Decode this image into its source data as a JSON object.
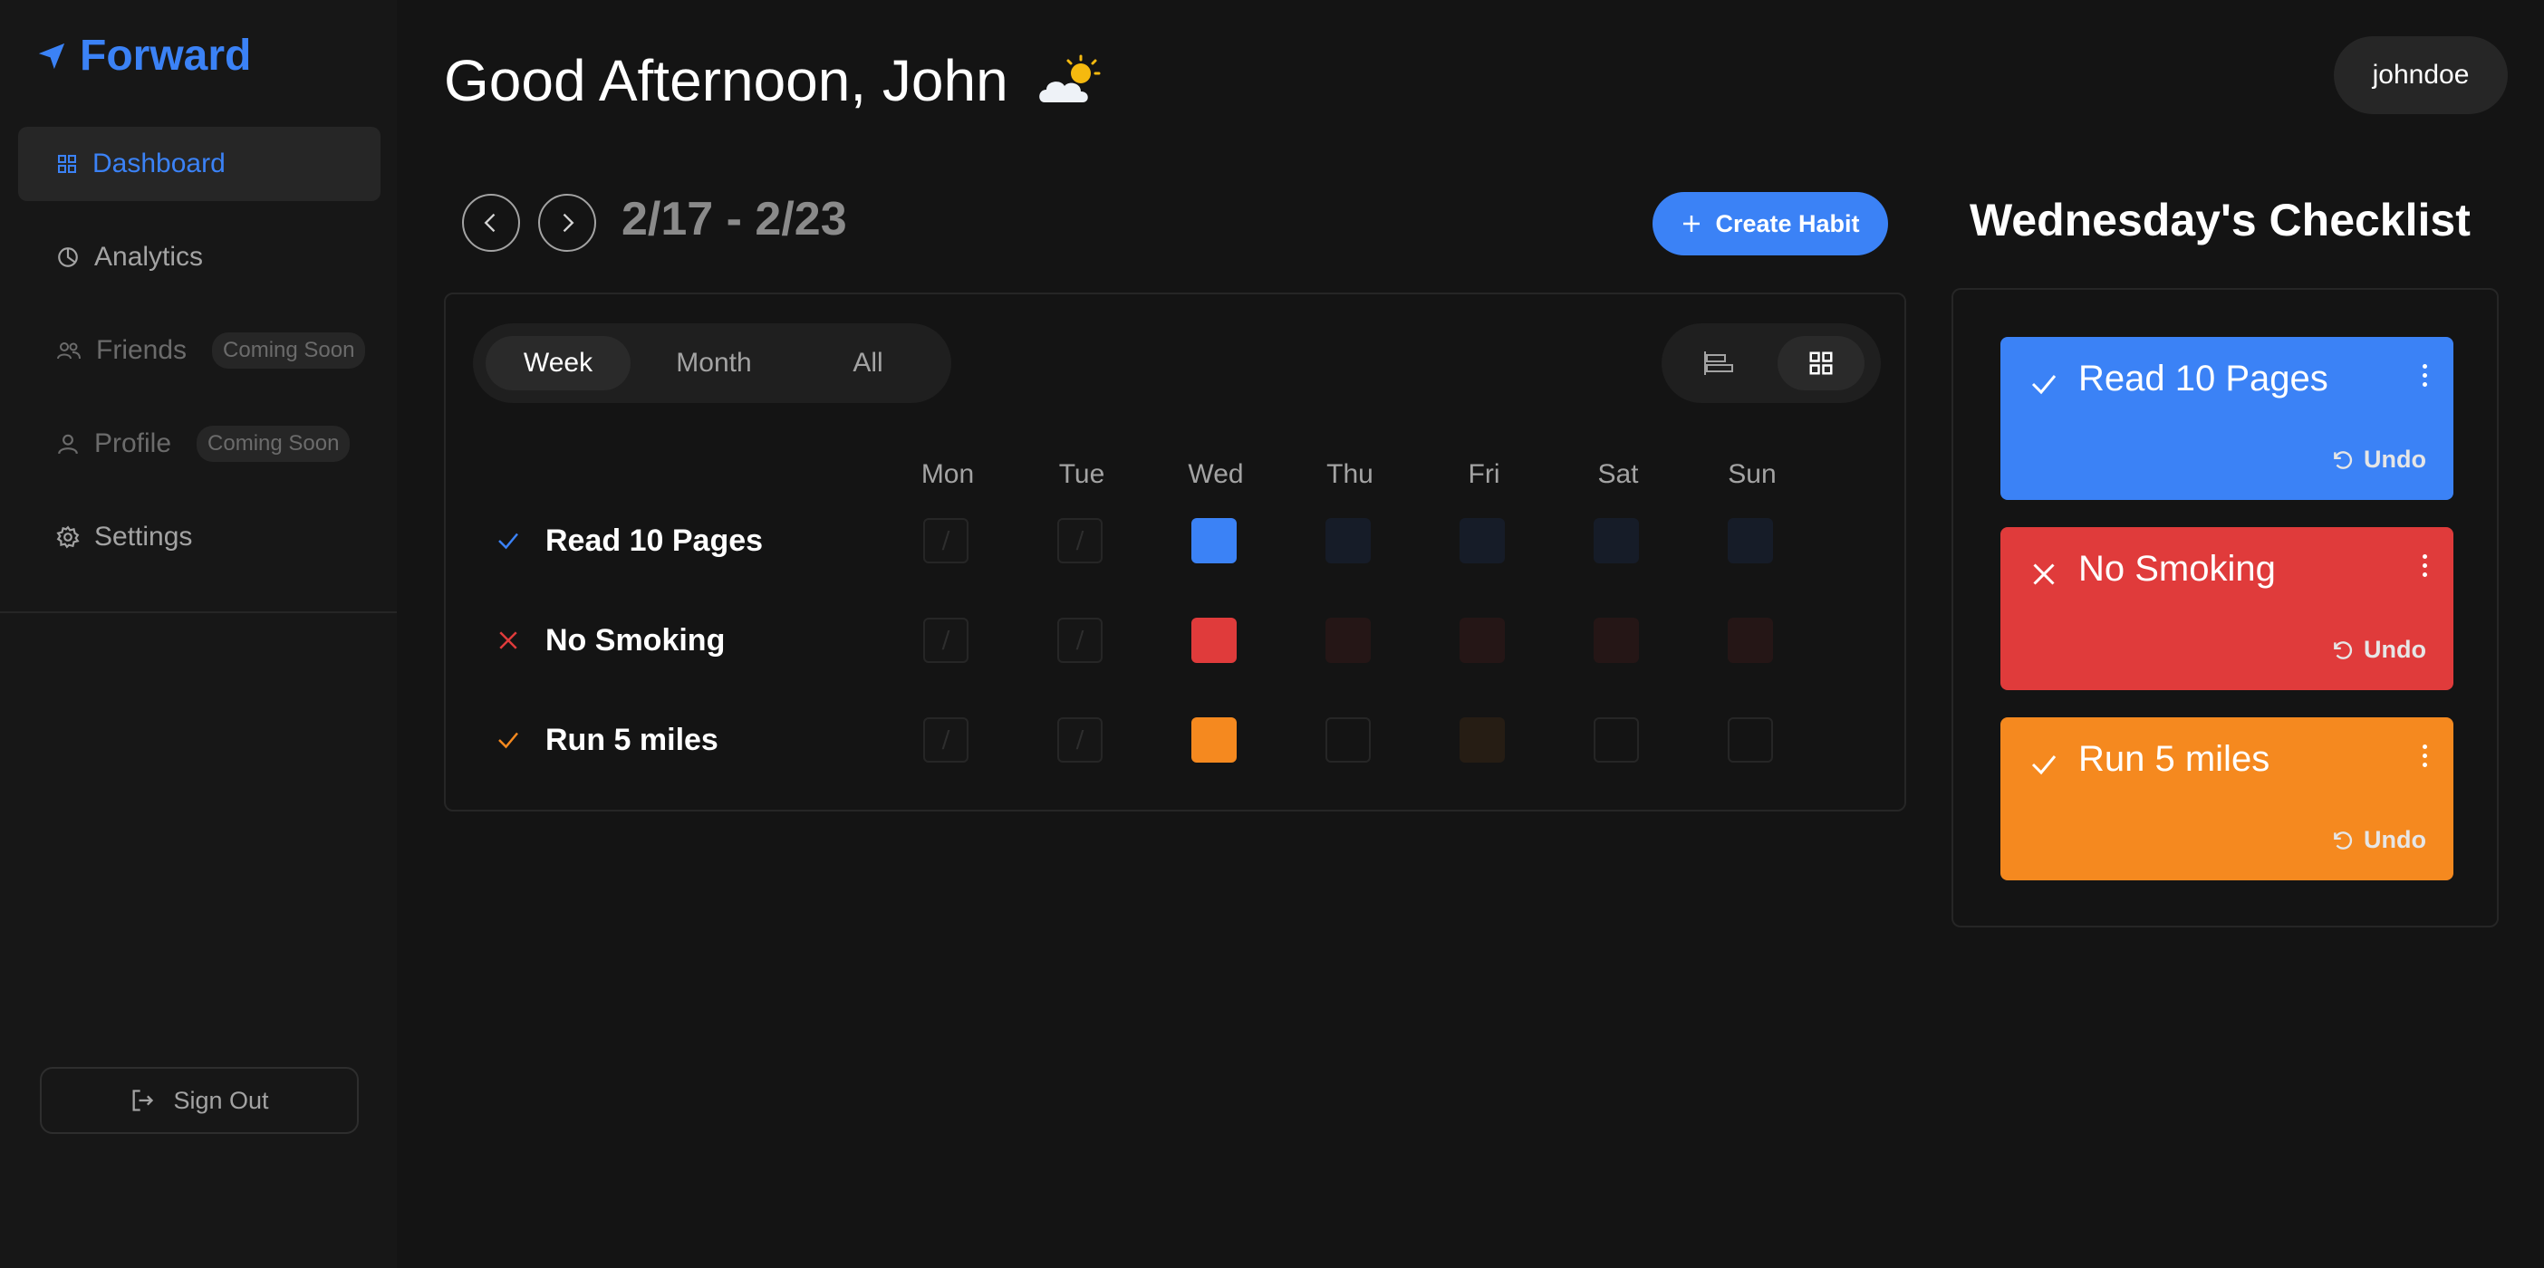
{
  "app": {
    "name": "Forward"
  },
  "sidebar": {
    "items": [
      {
        "label": "Dashboard",
        "icon": "grid-icon"
      },
      {
        "label": "Analytics",
        "icon": "pie-chart-icon"
      },
      {
        "label": "Friends",
        "icon": "users-icon",
        "badge": "Coming Soon"
      },
      {
        "label": "Profile",
        "icon": "user-icon",
        "badge": "Coming Soon"
      },
      {
        "label": "Settings",
        "icon": "gear-icon"
      }
    ],
    "sign_out": "Sign Out"
  },
  "header": {
    "greeting": "Good Afternoon, John",
    "weather": "partly-sunny-icon",
    "username": "johndoe"
  },
  "week": {
    "range": "2/17 - 2/23",
    "create_label": "Create Habit"
  },
  "tabs": [
    "Week",
    "Month",
    "All"
  ],
  "days": [
    "Mon",
    "Tue",
    "Wed",
    "Thu",
    "Fri",
    "Sat",
    "Sun"
  ],
  "habits": [
    {
      "name": "Read 10 Pages",
      "status": "done",
      "color": "#3b82f6"
    },
    {
      "name": "No Smoking",
      "status": "failed",
      "color": "#e03b3b"
    },
    {
      "name": "Run 5 miles",
      "status": "done",
      "color": "#f5891f"
    }
  ],
  "checklist": {
    "title": "Wednesday's Checklist",
    "items": [
      {
        "name": "Read 10 Pages",
        "undo": "Undo",
        "color": "#3b82f6"
      },
      {
        "name": "No Smoking",
        "undo": "Undo",
        "color": "#e03b3b"
      },
      {
        "name": "Run 5 miles",
        "undo": "Undo",
        "color": "#f5891f"
      }
    ]
  },
  "colors": {
    "accent": "#3b82f6",
    "red": "#e03b3b",
    "orange": "#f5891f",
    "background": "#141414"
  }
}
